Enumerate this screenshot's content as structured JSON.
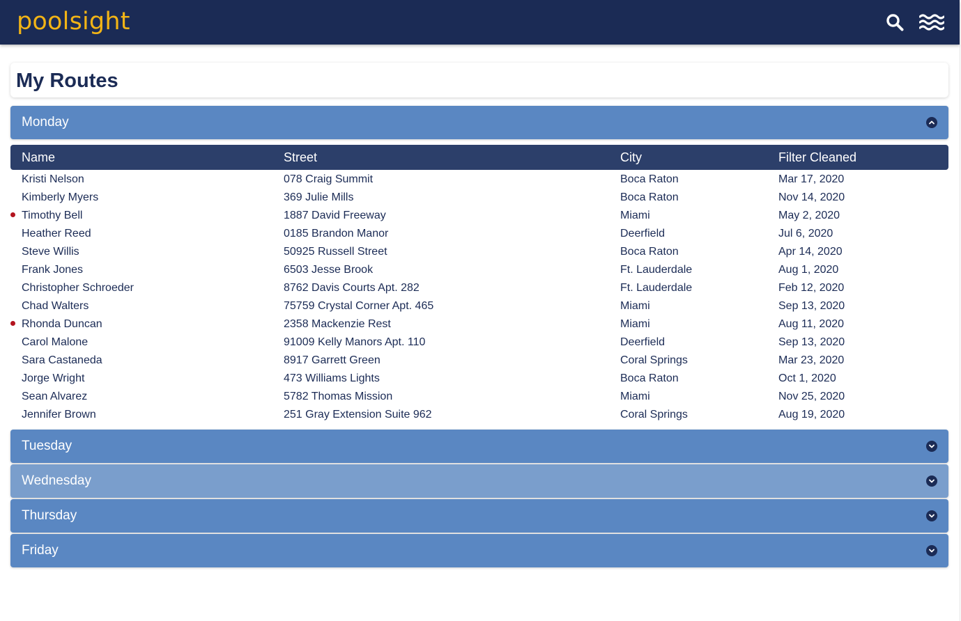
{
  "app": {
    "logo": "poolsight",
    "search_icon": "search-icon",
    "menu_icon": "waves-menu-icon"
  },
  "colors": {
    "navbar": "#1b2b55",
    "logo": "#f2b416",
    "panel": "#5a87c2",
    "panel_hover": "#7a9ecc",
    "table_header": "#2c3f6a",
    "alert_dot": "#b3141e"
  },
  "page": {
    "title": "My Routes"
  },
  "table": {
    "columns": [
      "Name",
      "Street",
      "City",
      "Filter Cleaned"
    ]
  },
  "days": [
    {
      "label": "Monday",
      "expanded": true,
      "icon": "chevron-up-icon"
    },
    {
      "label": "Tuesday",
      "expanded": false,
      "icon": "chevron-down-icon"
    },
    {
      "label": "Wednesday",
      "expanded": false,
      "icon": "chevron-down-icon"
    },
    {
      "label": "Thursday",
      "expanded": false,
      "icon": "chevron-down-icon"
    },
    {
      "label": "Friday",
      "expanded": false,
      "icon": "chevron-down-icon"
    }
  ],
  "monday_rows": [
    {
      "name": "Kristi Nelson",
      "street": "078 Craig Summit",
      "city": "Boca Raton",
      "date": "Mar 17, 2020",
      "flag": false
    },
    {
      "name": "Kimberly Myers",
      "street": "369 Julie Mills",
      "city": "Boca Raton",
      "date": "Nov 14, 2020",
      "flag": false
    },
    {
      "name": "Timothy Bell",
      "street": "1887 David Freeway",
      "city": "Miami",
      "date": "May 2, 2020",
      "flag": true
    },
    {
      "name": "Heather Reed",
      "street": "0185 Brandon Manor",
      "city": "Deerfield",
      "date": "Jul 6, 2020",
      "flag": false
    },
    {
      "name": "Steve Willis",
      "street": "50925 Russell Street",
      "city": "Boca Raton",
      "date": "Apr 14, 2020",
      "flag": false
    },
    {
      "name": "Frank Jones",
      "street": "6503 Jesse Brook",
      "city": "Ft. Lauderdale",
      "date": "Aug 1, 2020",
      "flag": false
    },
    {
      "name": "Christopher Schroeder",
      "street": "8762 Davis Courts Apt. 282",
      "city": "Ft. Lauderdale",
      "date": "Feb 12, 2020",
      "flag": false
    },
    {
      "name": "Chad Walters",
      "street": "75759 Crystal Corner Apt. 465",
      "city": "Miami",
      "date": "Sep 13, 2020",
      "flag": false
    },
    {
      "name": "Rhonda Duncan",
      "street": "2358 Mackenzie Rest",
      "city": "Miami",
      "date": "Aug 11, 2020",
      "flag": true
    },
    {
      "name": "Carol Malone",
      "street": "91009 Kelly Manors Apt. 110",
      "city": "Deerfield",
      "date": "Sep 13, 2020",
      "flag": false
    },
    {
      "name": "Sara Castaneda",
      "street": "8917 Garrett Green",
      "city": "Coral Springs",
      "date": "Mar 23, 2020",
      "flag": false
    },
    {
      "name": "Jorge Wright",
      "street": "473 Williams Lights",
      "city": "Boca Raton",
      "date": "Oct 1, 2020",
      "flag": false
    },
    {
      "name": "Sean Alvarez",
      "street": "5782 Thomas Mission",
      "city": "Miami",
      "date": "Nov 25, 2020",
      "flag": false
    },
    {
      "name": "Jennifer Brown",
      "street": "251 Gray Extension Suite 962",
      "city": "Coral Springs",
      "date": "Aug 19, 2020",
      "flag": false
    }
  ]
}
